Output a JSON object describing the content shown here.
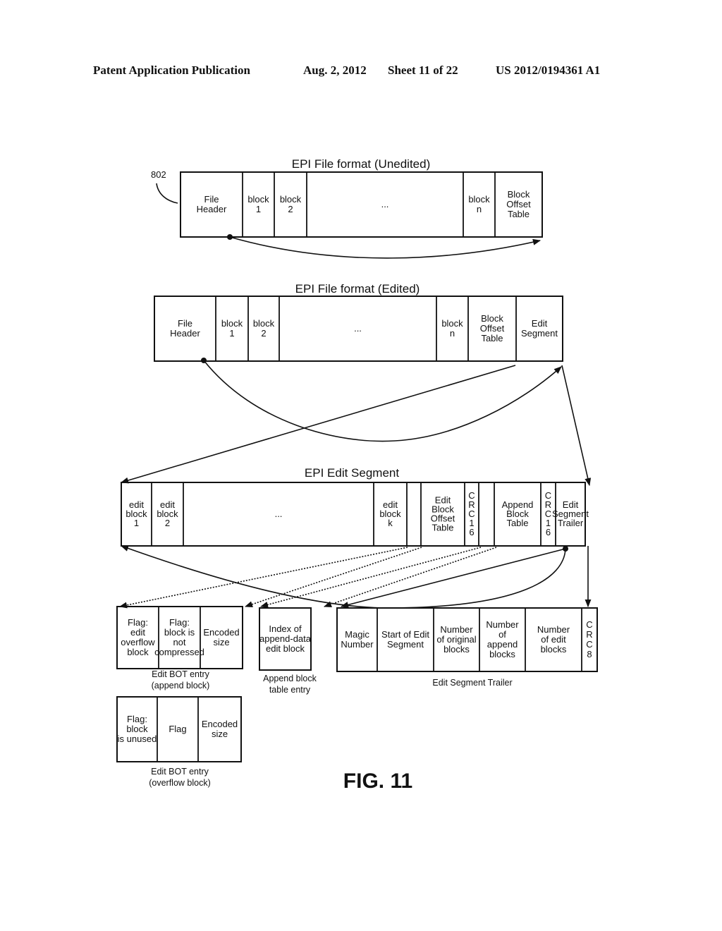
{
  "header": {
    "publication": "Patent Application Publication",
    "date": "Aug. 2, 2012",
    "sheet": "Sheet 11 of 22",
    "number": "US 2012/0194361 A1"
  },
  "ref_label": "802",
  "unedited": {
    "title": "EPI File format (Unedited)",
    "cells": [
      [
        "File",
        "Header"
      ],
      [
        "block",
        "1"
      ],
      [
        "block",
        "2"
      ],
      [
        "..."
      ],
      [
        "block",
        "n"
      ],
      [
        "Block",
        "Offset",
        "Table"
      ]
    ]
  },
  "edited": {
    "title": "EPI File format (Edited)",
    "cells": [
      [
        "File",
        "Header"
      ],
      [
        "block",
        "1"
      ],
      [
        "block",
        "2"
      ],
      [
        "..."
      ],
      [
        "block",
        "n"
      ],
      [
        "Block",
        "Offset",
        "Table"
      ],
      [
        "Edit",
        "Segment"
      ]
    ]
  },
  "edit_segment": {
    "title": "EPI Edit Segment",
    "cells": [
      [
        "edit",
        "block",
        "1"
      ],
      [
        "edit",
        "block",
        "2"
      ],
      [
        "..."
      ],
      [
        "edit",
        "block",
        "k"
      ],
      [
        ""
      ],
      [
        "Edit",
        "Block",
        "Offset",
        "Table"
      ],
      [
        "C",
        "R",
        "C",
        "1",
        "6"
      ],
      [
        ""
      ],
      [
        "Append",
        "Block",
        "Table"
      ],
      [
        "C",
        "R",
        "C",
        "1",
        "6"
      ],
      [
        "Edit",
        "Segment",
        "Trailer"
      ]
    ]
  },
  "bot_append": {
    "caption": [
      "Edit BOT entry",
      "(append block)"
    ],
    "cells": [
      [
        "Flag:",
        "edit",
        "overflow",
        "block"
      ],
      [
        "Flag:",
        "block is",
        "not",
        "compressed"
      ],
      [
        "Encoded",
        "size"
      ]
    ]
  },
  "append_entry": {
    "caption": [
      "Append block",
      "table entry"
    ],
    "cells": [
      [
        "Index of",
        "append-data",
        "edit block"
      ]
    ]
  },
  "trailer": {
    "caption": [
      "Edit Segment Trailer"
    ],
    "cells": [
      [
        "Magic",
        "Number"
      ],
      [
        "Start of Edit",
        "Segment"
      ],
      [
        "Number",
        "of original",
        "blocks"
      ],
      [
        "Number",
        "of",
        "append",
        "blocks"
      ],
      [
        "Number",
        "of edit",
        "blocks"
      ],
      [
        "C",
        "R",
        "C",
        "8"
      ]
    ]
  },
  "bot_overflow": {
    "caption": [
      "Edit BOT entry",
      "(overflow block)"
    ],
    "cells": [
      [
        "Flag:",
        "block",
        "is unused"
      ],
      [
        "Flag"
      ],
      [
        "Encoded",
        "size"
      ]
    ]
  },
  "figure_label": "FIG. 11"
}
